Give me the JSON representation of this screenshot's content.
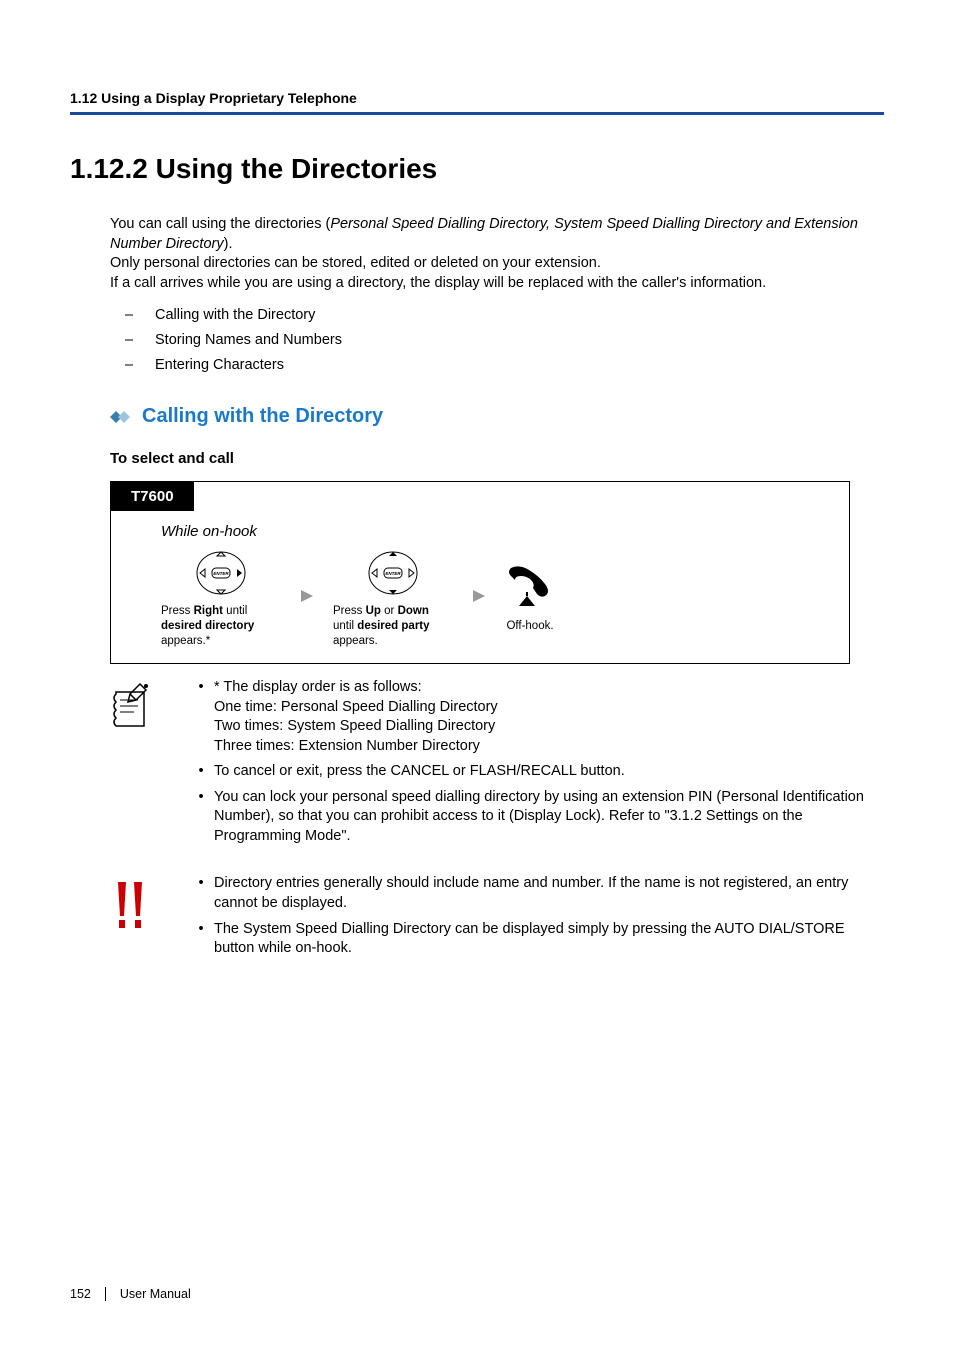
{
  "header": {
    "section_number": "1.12 Using a Display Proprietary Telephone"
  },
  "main_heading": "1.12.2  Using the Directories",
  "intro": {
    "line1_a": "You can call using the directories (",
    "line1_b": "Personal Speed Dialling Directory, System Speed Dialling Directory and Extension Number Directory",
    "line1_c": ").",
    "line2": "Only personal directories can be stored, edited or deleted on your extension.",
    "line3": "If a call arrives while you are using a directory, the display will be replaced with the caller's information."
  },
  "dash_list": [
    "Calling with the Directory",
    "Storing Names and Numbers",
    "Entering Characters"
  ],
  "subheading": "Calling with the Directory",
  "sub_caption": "To select and call",
  "diagram": {
    "model": "T7600",
    "precondition": "While on-hook",
    "step1_a": "Press ",
    "step1_b": "Right",
    "step1_c": " until ",
    "step1_d": "desired directory",
    "step1_e": " appears.*",
    "step2_a": "Press ",
    "step2_b": "Up",
    "step2_c": " or ",
    "step2_d": "Down",
    "step2_e": " until ",
    "step2_f": "desired party",
    "step2_g": " appears.",
    "step3": "Off-hook."
  },
  "notes": {
    "items": [
      {
        "lead": "* The display order is as follows:",
        "sublines": [
          "One time: Personal Speed Dialling Directory",
          "Two times: System Speed Dialling Directory",
          "Three times: Extension Number Directory"
        ]
      },
      {
        "text": "To cancel or exit, press the CANCEL or FLASH/RECALL button."
      },
      {
        "text": "You can lock your personal speed dialling directory by using an extension PIN (Personal Identification Number), so that you can prohibit access to it (Display Lock). Refer to \"3.1.2 Settings on the Programming Mode\"."
      }
    ]
  },
  "warnings": {
    "items": [
      "Directory entries generally should include name and number. If the name is not registered, an entry cannot be displayed.",
      "The System Speed Dialling Directory can be displayed simply by pressing the AUTO DIAL/STORE button while on-hook."
    ]
  },
  "footer": {
    "page": "152",
    "label": "User Manual"
  }
}
